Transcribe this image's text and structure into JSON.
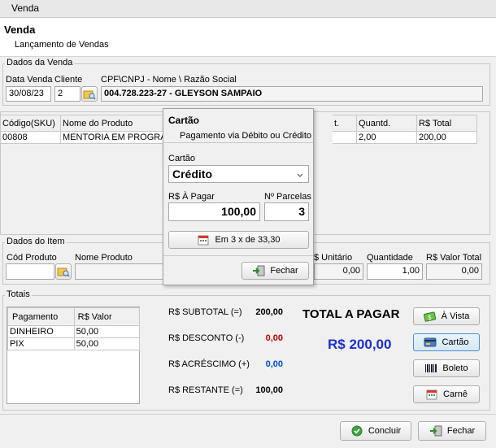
{
  "window": {
    "title": "Venda"
  },
  "header": {
    "title": "Venda",
    "subtitle": "Lançamento de Vendas"
  },
  "dados_venda": {
    "group_title": "Dados da Venda",
    "date_label": "Data Venda",
    "client_label": "Cliente",
    "cpf_label": "CPF\\CNPJ - Nome \\ Razão Social",
    "date_value": "30/08/23",
    "client_code": "2",
    "client_name": "004.728.223-27 - GLEYSON SAMPAIO"
  },
  "items_grid": {
    "columns": [
      "Código(SKU)",
      "Nome do Produto",
      "t.",
      "Quantd.",
      "R$ Total"
    ],
    "rows": [
      {
        "sku": "00808",
        "name": "MENTORIA EM PROGRAMA",
        "qty": "2,00",
        "total": "200,00"
      }
    ]
  },
  "dados_item": {
    "group_title": "Dados do Item",
    "cod_label": "Cód Produto",
    "nome_label": "Nome Produto",
    "unit_label": "$ Unitário",
    "qty_label": "Quantidade",
    "total_label": "R$ Valor Total",
    "unit_value": "0,00",
    "qty_value": "1,00",
    "total_value": "0,00"
  },
  "totais": {
    "group_title": "Totais",
    "pay_columns": [
      "Pagamento",
      "R$ Valor"
    ],
    "payments": [
      {
        "method": "DINHEIRO",
        "value": "50,00"
      },
      {
        "method": "PIX",
        "value": "50,00"
      }
    ],
    "subtotal_label": "R$ SUBTOTAL (=)",
    "subtotal_value": "200,00",
    "desconto_label": "R$ DESCONTO (-)",
    "desconto_value": "0,00",
    "acrescimo_label": "R$ ACRÉSCIMO (+)",
    "acrescimo_value": "0,00",
    "restante_label": "R$ RESTANTE (=)",
    "restante_value": "100,00",
    "total_pagar_label": "TOTAL A PAGAR",
    "total_pagar_value": "R$ 200,00",
    "btn_vista": "À Vista",
    "btn_cartao": "Cartão",
    "btn_boleto": "Boleto",
    "btn_carne": "Carnê"
  },
  "footer": {
    "btn_concluir": "Concluir",
    "btn_fechar": "Fechar"
  },
  "cartao_popup": {
    "title": "Cartão",
    "subtitle": "Pagamento via Débito ou Crédito",
    "type_label": "Cartão",
    "type_value": "Crédito",
    "apagar_label": "R$ À Pagar",
    "apagar_value": "100,00",
    "parcelas_label": "Nº Parcelas",
    "parcelas_value": "3",
    "installments_button": "Em 3 x de 33,30",
    "close_button": "Fechar"
  },
  "colors": {
    "desconto": "#c00000",
    "acrescimo": "#0050d0",
    "total": "#1c2fd0",
    "header_bg": "#ffffff"
  }
}
